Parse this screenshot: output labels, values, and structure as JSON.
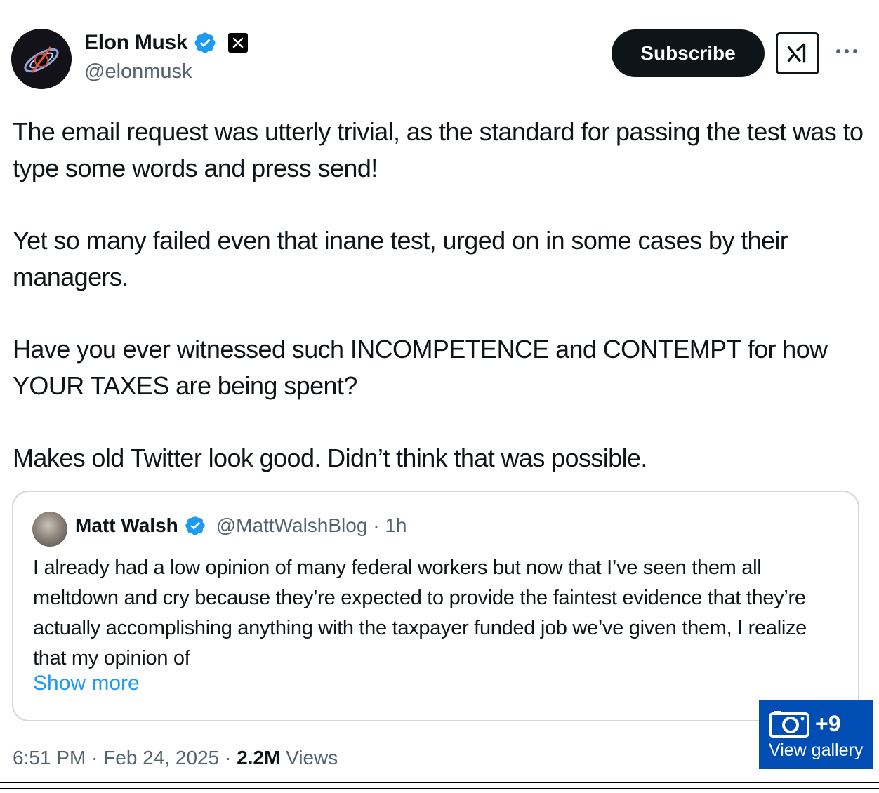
{
  "author": {
    "display_name": "Elon Musk",
    "handle": "@elonmusk",
    "avatar_icon": "galaxy-avatar",
    "verified_icon": "verified-badge-icon",
    "affiliate_icon": "x-logo-icon"
  },
  "actions": {
    "subscribe_label": "Subscribe",
    "grok_icon": "grok-icon",
    "more_icon": "more-options-icon"
  },
  "tweet": {
    "paragraphs": [
      "The email request was utterly trivial, as the standard for passing the test was to type some words and press send!",
      "Yet so many failed even that inane test, urged on in some cases by their managers.",
      "Have you ever witnessed such INCOMPETENCE and CONTEMPT for how YOUR TAXES are being spent?",
      "Makes old Twitter look good. Didn’t think that was possible."
    ]
  },
  "quoted": {
    "display_name": "Matt Walsh",
    "handle_time": "@MattWalshBlog · 1h",
    "text": "I already had a low opinion of many federal workers but now that I’ve seen them all meltdown and cry because they’re expected to provide the faintest evidence that they’re actually accomplishing anything with the taxpayer funded job we’ve given them, I realize that my opinion of",
    "show_more_label": "Show more"
  },
  "meta": {
    "timestamp": "6:51 PM · Feb 24, 2025 · ",
    "views_count": "2.2M",
    "views_label": " Views"
  },
  "gallery": {
    "count": "+9",
    "label": "View gallery",
    "icon": "camera-icon"
  },
  "colors": {
    "accent_blue": "#1d9bf0",
    "gallery_bg": "#004db3",
    "text_primary": "#0f1419",
    "text_secondary": "#536471"
  }
}
